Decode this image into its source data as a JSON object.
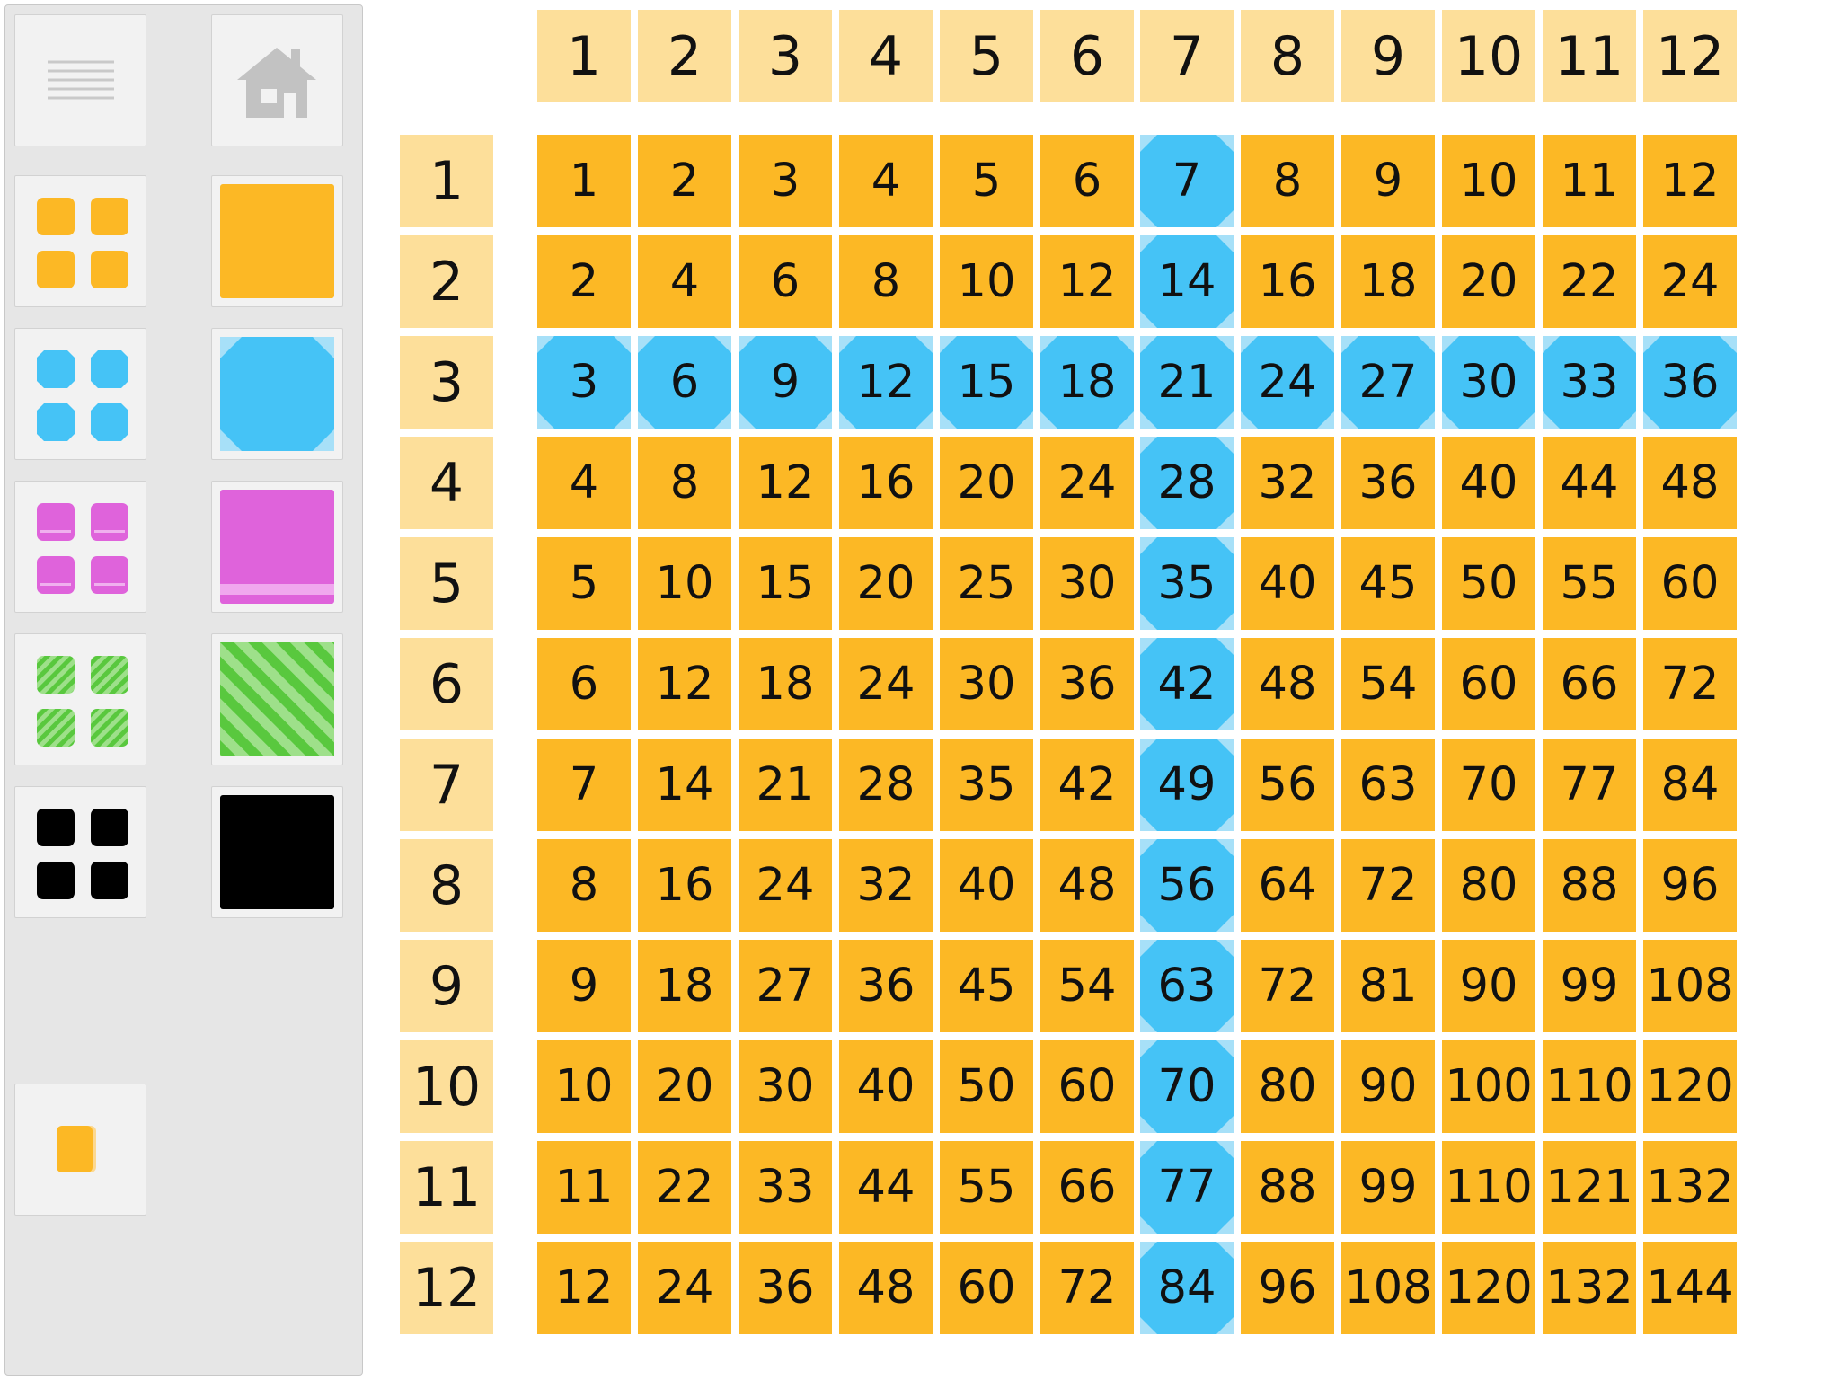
{
  "sidebar": {
    "menu_icon": "menu-lines-icon",
    "home_icon": "home-icon",
    "styles": [
      {
        "name": "orange",
        "color": "#fcb825",
        "shape": "square",
        "icon": "orange-grid-icon"
      },
      {
        "name": "blue",
        "color": "#45c3f6",
        "shape": "octagon",
        "icon": "blue-grid-icon"
      },
      {
        "name": "pink",
        "color": "#df63db",
        "shape": "banded",
        "icon": "pink-grid-icon"
      },
      {
        "name": "green",
        "color": "#59c83e",
        "shape": "striped",
        "icon": "green-grid-icon"
      },
      {
        "name": "black",
        "color": "#000000",
        "shape": "rounded",
        "icon": "black-grid-icon"
      }
    ],
    "bottom_tool_icon": "orange-tile-icon"
  },
  "colors": {
    "header_bg": "#fddf9a",
    "orange": "#fcb825",
    "blue": "#45c3f6"
  },
  "column_headers": [
    "1",
    "2",
    "3",
    "4",
    "5",
    "6",
    "7",
    "8",
    "9",
    "10",
    "11",
    "12"
  ],
  "row_headers": [
    "1",
    "2",
    "3",
    "4",
    "5",
    "6",
    "7",
    "8",
    "9",
    "10",
    "11",
    "12"
  ],
  "grid": [
    [
      "1",
      "2",
      "3",
      "4",
      "5",
      "6",
      "7",
      "8",
      "9",
      "10",
      "11",
      "12"
    ],
    [
      "2",
      "4",
      "6",
      "8",
      "10",
      "12",
      "14",
      "16",
      "18",
      "20",
      "22",
      "24"
    ],
    [
      "3",
      "6",
      "9",
      "12",
      "15",
      "18",
      "21",
      "24",
      "27",
      "30",
      "33",
      "36"
    ],
    [
      "4",
      "8",
      "12",
      "16",
      "20",
      "24",
      "28",
      "32",
      "36",
      "40",
      "44",
      "48"
    ],
    [
      "5",
      "10",
      "15",
      "20",
      "25",
      "30",
      "35",
      "40",
      "45",
      "50",
      "55",
      "60"
    ],
    [
      "6",
      "12",
      "18",
      "24",
      "30",
      "36",
      "42",
      "48",
      "54",
      "60",
      "66",
      "72"
    ],
    [
      "7",
      "14",
      "21",
      "28",
      "35",
      "42",
      "49",
      "56",
      "63",
      "70",
      "77",
      "84"
    ],
    [
      "8",
      "16",
      "24",
      "32",
      "40",
      "48",
      "56",
      "64",
      "72",
      "80",
      "88",
      "96"
    ],
    [
      "9",
      "18",
      "27",
      "36",
      "45",
      "54",
      "63",
      "72",
      "81",
      "90",
      "99",
      "108"
    ],
    [
      "10",
      "20",
      "30",
      "40",
      "50",
      "60",
      "70",
      "80",
      "90",
      "100",
      "110",
      "120"
    ],
    [
      "11",
      "22",
      "33",
      "44",
      "55",
      "66",
      "77",
      "88",
      "99",
      "110",
      "121",
      "132"
    ],
    [
      "12",
      "24",
      "36",
      "48",
      "60",
      "72",
      "84",
      "96",
      "108",
      "120",
      "132",
      "144"
    ]
  ],
  "highlighted_row": "3",
  "highlighted_column": "7"
}
